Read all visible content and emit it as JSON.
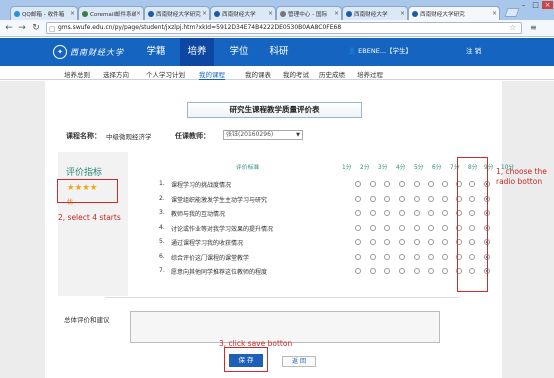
{
  "browser": {
    "tabs": [
      {
        "label": "QQ邮箱 - 收件箱",
        "color": "#2a8fd6"
      },
      {
        "label": "Coremail邮件系统",
        "color": "#3a7d3a"
      },
      {
        "label": "西南财经大学研究",
        "color": "#1e5aa8"
      },
      {
        "label": "西南财经大学",
        "color": "#1e5aa8"
      },
      {
        "label": "管理中心 - 国际",
        "color": "#777777"
      },
      {
        "label": "西南财经大学",
        "color": "#1e5aa8"
      },
      {
        "label": "西南财经大学研究",
        "color": "#1e5aa8"
      }
    ],
    "url": "gms.swufe.edu.cn/py/page/student/jxzlpj.htm?xkId=5912D34E74B4222DE0530B0AA8C0FE68"
  },
  "site": {
    "logo_text": "西南财经大学",
    "nav": [
      "学籍",
      "培养",
      "学位",
      "科研"
    ],
    "user": "EBENE...【学生】",
    "logout": "注 销"
  },
  "subnav": [
    "培养总则",
    "选择方向",
    "个人学习计划",
    "我的课程",
    "我的课表",
    "我的考试",
    "历史成绩",
    "培养过程"
  ],
  "form": {
    "title": "研究生课程教学质量评价表",
    "course_label": "课程名称：",
    "course_value": "中级微观经济学",
    "teacher_label": "任课教师：",
    "teacher_value": "张钰(20160296)",
    "indicator_title": "评价指标",
    "criteria_header": "评价标准",
    "score_headers": [
      "1分",
      "2分",
      "3分",
      "4分",
      "5分",
      "6分",
      "7分",
      "8分",
      "9分",
      "10分"
    ],
    "stars": "★★★★",
    "star_note": "优",
    "questions": [
      {
        "n": "1.",
        "text": "课程学习的挑战度情况"
      },
      {
        "n": "2.",
        "text": "课堂组织能激发学生主动学习与研究"
      },
      {
        "n": "3.",
        "text": "教师与我的互动情况"
      },
      {
        "n": "4.",
        "text": "讨论或作业等对我学习效果的提升情况"
      },
      {
        "n": "5.",
        "text": "通过课程学习我的收获情况"
      },
      {
        "n": "6.",
        "text": "综合评价这门课程的课堂教学"
      },
      {
        "n": "7.",
        "text": "愿意向其他同学推荐这位教师的程度"
      }
    ],
    "selected_score_index": 9,
    "summary_label": "总体评价和建议",
    "save_label": "保  存",
    "back_label": "返  回"
  },
  "annotations": {
    "a1": "1, choose the radio botton",
    "a2": "2, select 4 starts",
    "a3": "3, click save botton",
    "color": "#c62828"
  }
}
